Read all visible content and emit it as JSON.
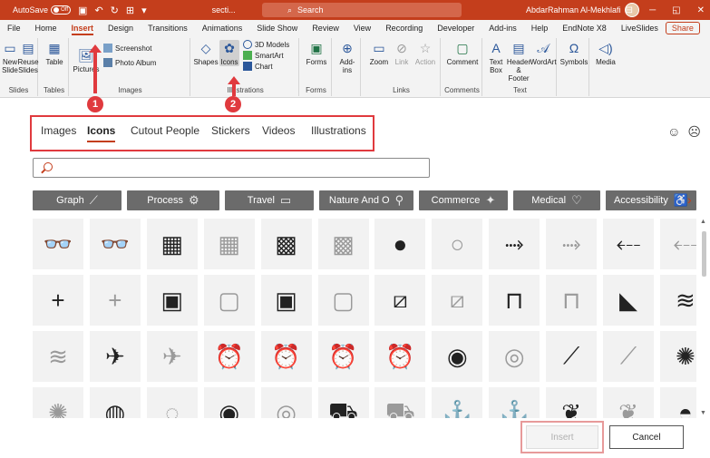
{
  "titlebar": {
    "autosave_label": "AutoSave",
    "autosave_state": "Off",
    "filename": "secti...",
    "search_placeholder": "Search",
    "user_name": "AbdarRahman Al-Mekhlafi"
  },
  "ribbon_tabs": [
    "File",
    "Home",
    "Insert",
    "Design",
    "Transitions",
    "Animations",
    "Slide Show",
    "Review",
    "View",
    "Recording",
    "Developer",
    "Add-ins",
    "Help",
    "EndNote X8",
    "LiveSlides"
  ],
  "active_ribbon_tab": "Insert",
  "share_label": "Share",
  "ribbon": {
    "slides": {
      "new_slide": "New Slide",
      "reuse_slides": "Reuse Slides",
      "label": "Slides"
    },
    "tables": {
      "table": "Table",
      "label": "Tables"
    },
    "images": {
      "pictures": "Pictures",
      "screenshot": "Screenshot",
      "photo_album": "Photo Album",
      "label": "Images"
    },
    "illustrations": {
      "shapes": "Shapes",
      "icons": "Icons",
      "models_3d": "3D Models",
      "smartart": "SmartArt",
      "chart": "Chart",
      "label": "Illustrations"
    },
    "forms": {
      "forms": "Forms",
      "label": "Forms"
    },
    "addins": {
      "addins": "Add-ins"
    },
    "links": {
      "zoom": "Zoom",
      "link": "Link",
      "action": "Action",
      "label": "Links"
    },
    "comments": {
      "comment": "Comment",
      "label": "Comments"
    },
    "text": {
      "text_box": "Text Box",
      "header_footer": "Header & Footer",
      "wordart": "WordArt",
      "label": "Text"
    },
    "symbols": {
      "symbols": "Symbols"
    },
    "media": {
      "media": "Media"
    }
  },
  "markers": {
    "one": "1",
    "two": "2"
  },
  "dialog": {
    "tabs": [
      "Images",
      "Icons",
      "Cutout People",
      "Stickers",
      "Videos",
      "Illustrations"
    ],
    "active_tab": "Icons",
    "search_placeholder": "",
    "categories": [
      "Graph",
      "Process",
      "Travel",
      "Nature And Outdoors",
      "Commerce",
      "Medical",
      "Accessibility"
    ],
    "category_display": [
      "Graph",
      "Process",
      "Travel",
      "Nature And O",
      "Commerce",
      "Medical",
      "Accessibility"
    ],
    "insert_label": "Insert",
    "cancel_label": "Cancel"
  },
  "icon_rows": [
    [
      "3d-glasses",
      "3d-glasses-outline",
      "abacus",
      "abacus-outline",
      "abacus-wide",
      "abacus-wide-outline",
      "acorn",
      "acorn-outline",
      "arrow-bent",
      "arrow-bent-outline",
      "arrow-left-bent",
      "arrow-left-bent-outline"
    ],
    [
      "plus",
      "plus-outline",
      "contact-card",
      "contact-card-outline",
      "contact-card-dark",
      "contact-card-dark-outline",
      "bandage",
      "bandage-outline",
      "billboard",
      "billboard-outline",
      "africa-map",
      "farm-landscape"
    ],
    [
      "farm-landscape-outline",
      "airplane",
      "airplane-outline",
      "alarm-clock",
      "alarm-clock-outline",
      "alarm-ringing",
      "alarm-ringing-outline",
      "alien",
      "alien-outline",
      "needle-thread",
      "needle-thread-outline",
      "yarn-ball"
    ],
    [
      "yarn-outline",
      "tape-measure",
      "tape-measure-outline",
      "target-ball",
      "target-ball-outline",
      "ambulance",
      "ambulance-outline",
      "anchor",
      "anchor-outline",
      "coral",
      "coral-outline",
      "face-mask"
    ]
  ],
  "colors": {
    "accent": "#c43e1c",
    "annotation": "#e03a3e",
    "category_bg": "#6b6b6b"
  }
}
